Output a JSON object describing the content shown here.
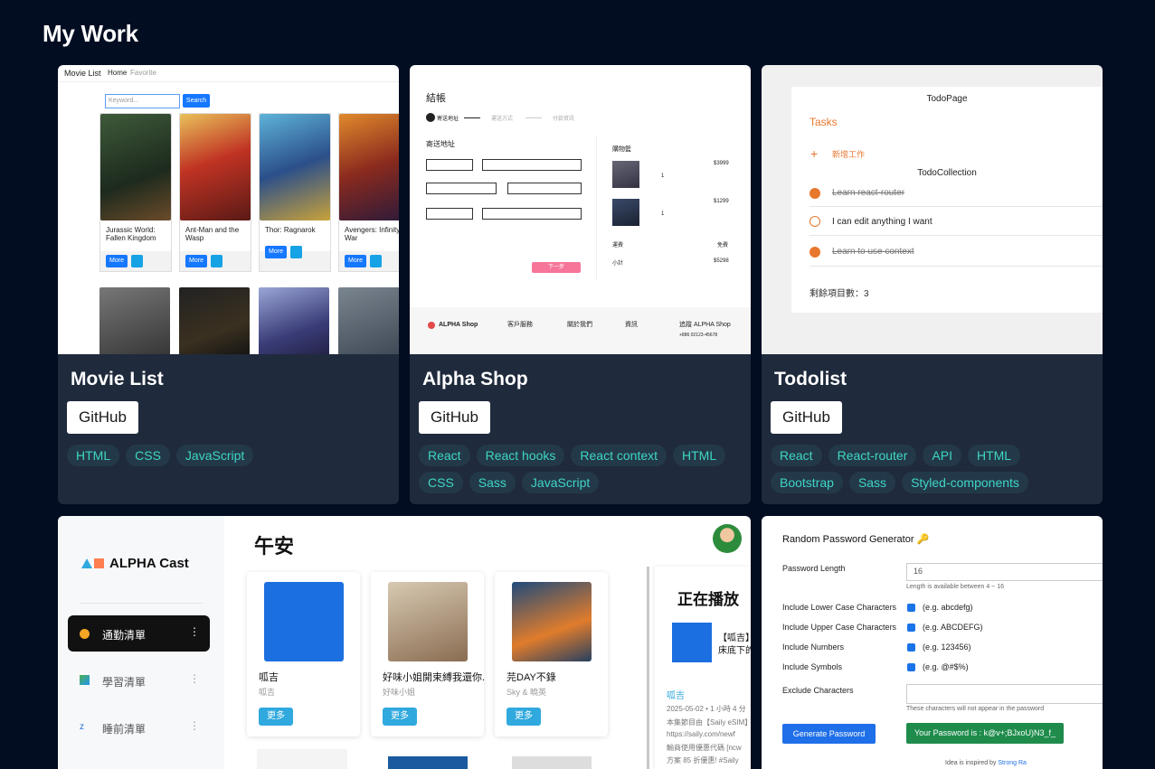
{
  "page_title": "My Work",
  "cards": [
    {
      "title": "Movie List",
      "github": "GitHub",
      "tags": [
        "HTML",
        "CSS",
        "JavaScript"
      ]
    },
    {
      "title": "Alpha Shop",
      "github": "GitHub",
      "tags": [
        "React",
        "React hooks",
        "React context",
        "HTML",
        "CSS",
        "Sass",
        "JavaScript"
      ]
    },
    {
      "title": "Todolist",
      "github": "GitHub",
      "tags": [
        "React",
        "React-router",
        "API",
        "HTML",
        "Bootstrap",
        "Sass",
        "Styled-components"
      ]
    }
  ],
  "movie_thumb": {
    "brand": "Movie List",
    "nav_home": "Home",
    "nav_fav": "Favorite",
    "search_placeholder": "Keyword...",
    "search_btn": "Search",
    "more": "More",
    "plus": "+",
    "movies": [
      "Jurassic World: Fallen Kingdom",
      "Ant-Man and the Wasp",
      "Thor: Ragnarok",
      "Avengers: Infinity War"
    ],
    "poster_colors": [
      "#2c3b2a",
      "#b3322a",
      "#2b6aa6",
      "#8a2a1e",
      "#3b3b44",
      "#1e2124",
      "#2a3564",
      "#4a5660"
    ]
  },
  "shop_thumb": {
    "heading": "結帳",
    "steps": [
      "寄送地址",
      "運送方式",
      "付款資訊"
    ],
    "form_title": "寄送地址",
    "cart_title": "購物籃",
    "prices": [
      "$3999",
      "$1299"
    ],
    "qty": [
      "1",
      "1"
    ],
    "shipping": "運費",
    "shipping_val": "免費",
    "total": "小計",
    "total_val": "$5298",
    "next": "下一步",
    "brand": "ALPHA Shop",
    "footer_cols": [
      "客戶服務",
      "關於我們",
      "資訊",
      "追蹤 ALPHA Shop"
    ],
    "phone": "+886 02123-45678"
  },
  "todo_thumb": {
    "page_name": "TodoPage",
    "tasks_label": "Tasks",
    "add_label": "新增工作",
    "collection": "TodoCollection",
    "items": [
      {
        "text": "Learn react-router",
        "done": true
      },
      {
        "text": "I can edit anything I want",
        "done": false
      },
      {
        "text": "Learn to use context",
        "done": true
      }
    ],
    "remaining": "剩餘項目數：3"
  },
  "cast_thumb": {
    "brand": "ALPHA Cast",
    "greeting": "午安",
    "nav": [
      "通勤清單",
      "學習清單",
      "睡前清單"
    ],
    "podcasts": [
      {
        "title": "呱吉",
        "author": "呱吉",
        "more": "更多"
      },
      {
        "title": "好味小姐開束縛我還你.",
        "author": "好味小姐",
        "more": "更多"
      },
      {
        "title": "芫DAY不錄",
        "author": "Sky & 曉英",
        "more": "更多"
      }
    ],
    "now_playing": "正在播放",
    "np_title": "【呱吉】",
    "np_sub": "床底下的",
    "np_channel": "呱吉",
    "np_meta": "2025-05-02 • 1 小時 4 分",
    "np_desc": [
      "本集節目由【Saily eSIM】",
      "https://saily.com/newf",
      "輸商使用優惠代碼 [ncw",
      "方案 85 折優惠! #Saily"
    ]
  },
  "pwd_thumb": {
    "title": "Random Password Generator 🔑",
    "length_label": "Password Length",
    "length_value": "16",
    "length_hint": "Length is available between 4 ~ 16",
    "options": [
      {
        "label": "Include Lower Case Characters",
        "example": "(e.g. abcdefg)"
      },
      {
        "label": "Include Upper Case Characters",
        "example": "(e.g. ABCDEFG)"
      },
      {
        "label": "Include Numbers",
        "example": "(e.g. 123456)"
      },
      {
        "label": "Include Symbols",
        "example": "(e.g. @#$%)"
      }
    ],
    "exclude_label": "Exclude Characters",
    "exclude_hint": "These characters will not appear in the password",
    "gen_btn": "Generate Password",
    "result": "Your Password is : k@v+;BJxoU)N3_f_",
    "footer": "Idea is inspired by",
    "footer_link": "Strong Ra"
  }
}
